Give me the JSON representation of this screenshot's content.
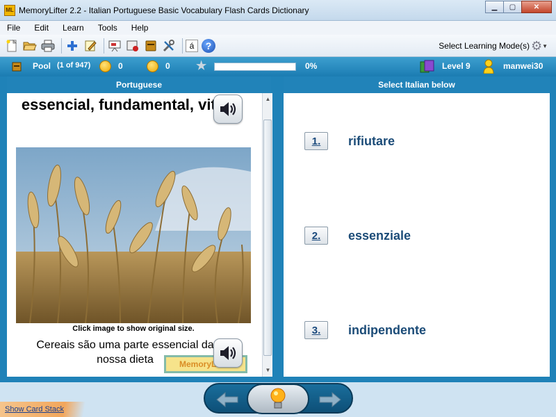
{
  "window": {
    "app_icon": "ML",
    "title": "MemoryLifter 2.2 - Italian Portuguese Basic Vocabulary Flash Cards Dictionary",
    "controls": [
      "minimize-icon",
      "maximize-icon",
      "close-icon"
    ]
  },
  "menu": [
    "File",
    "Edit",
    "Learn",
    "Tools",
    "Help"
  ],
  "toolbar": {
    "icons": [
      "new-icon",
      "open-icon",
      "print-icon",
      "add-icon",
      "edit-icon",
      "slideshow-icon",
      "record-icon",
      "book-icon",
      "tools-icon",
      "accent-icon",
      "help-icon"
    ],
    "accent_label": "á",
    "help_label": "?",
    "mode_label": "Select Learning Mode(s)"
  },
  "status": {
    "pool_label": "Pool",
    "pool_count": "(1 of 947)",
    "correct_count": "0",
    "wrong_count": "0",
    "progress_percent": 0,
    "progress_label": "0%",
    "level_label": "Level 9",
    "user_name": "manwei30"
  },
  "left_panel": {
    "header": "Portuguese",
    "question": "essencial, fundamental, vital",
    "image_caption": "Click image to show original size.",
    "example": "Cereais são uma parte essencial da nossa dieta",
    "watermark": "MemoryLifter"
  },
  "right_panel": {
    "header": "Select Italian below",
    "answers": [
      {
        "number": "1.",
        "text": "rifiutare"
      },
      {
        "number": "2.",
        "text": "essenziale"
      },
      {
        "number": "3.",
        "text": "indipendente"
      }
    ]
  },
  "bottom": {
    "show_card_stack": "Show Card Stack"
  },
  "colors": {
    "frame_blue": "#1f82b8",
    "answer_text": "#1c4c78",
    "progress_fill": "#6ac04b"
  }
}
